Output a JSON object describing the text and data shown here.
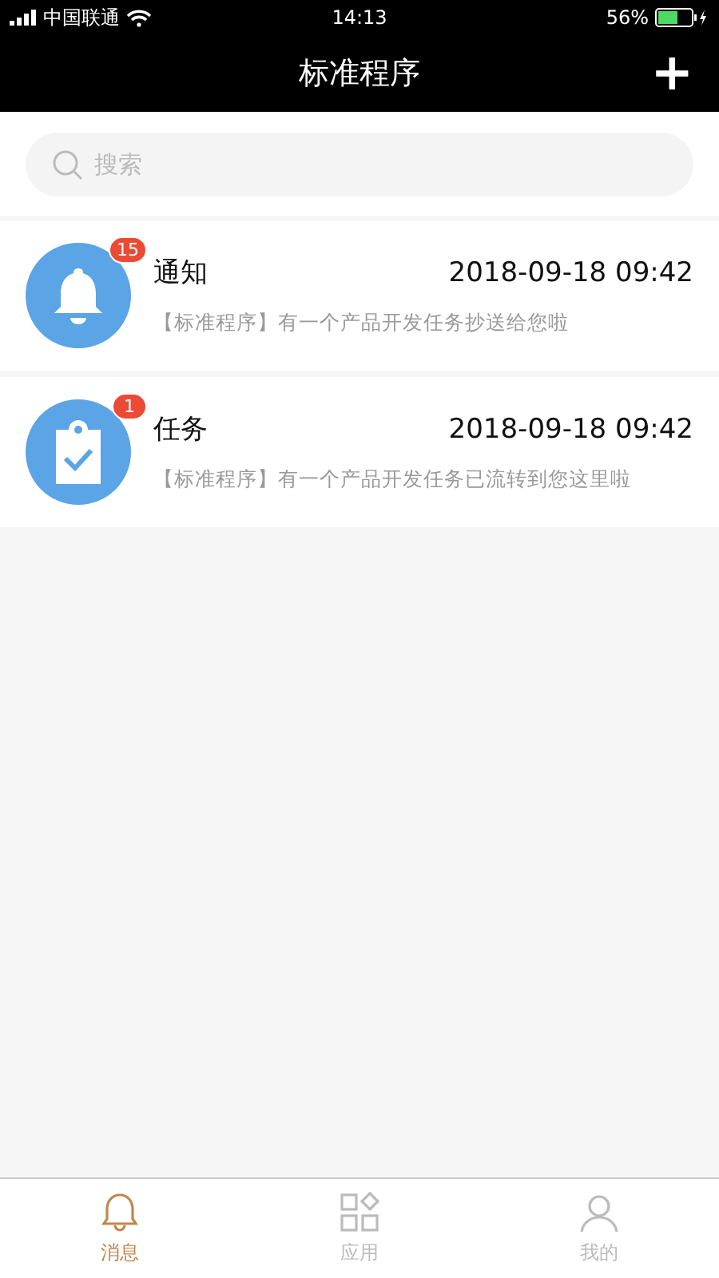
{
  "status_bar": {
    "carrier": "中国联通",
    "time": "14:13",
    "battery": "56%"
  },
  "header": {
    "title": "标准程序",
    "action": "+"
  },
  "search": {
    "placeholder": "搜索"
  },
  "messages": [
    {
      "kind": "bell",
      "title": "通知",
      "time": "2018-09-18 09:42",
      "preview": "【标准程序】有一个产品开发任务抄送给您啦",
      "badge": "15"
    },
    {
      "kind": "clipboard",
      "title": "任务",
      "time": "2018-09-18 09:42",
      "preview": "【标准程序】有一个产品开发任务已流转到您这里啦",
      "badge": "1"
    }
  ],
  "tab_bar": [
    {
      "kind": "bell",
      "label": "消息",
      "selected": true
    },
    {
      "kind": "apps",
      "label": "应用",
      "selected": false
    },
    {
      "kind": "person",
      "label": "我的",
      "selected": false
    }
  ]
}
